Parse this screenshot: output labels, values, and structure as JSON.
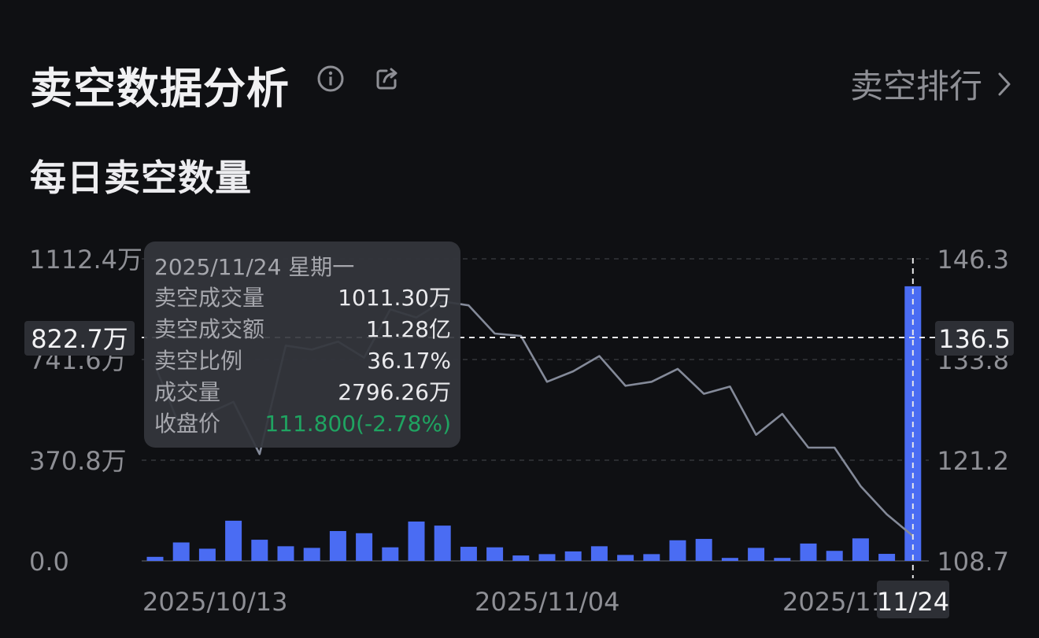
{
  "header": {
    "title": "卖空数据分析",
    "ranking_label": "卖空排行",
    "icons": [
      "info-icon",
      "share-icon",
      "chevron-right-icon"
    ]
  },
  "section": {
    "title": "每日卖空数量"
  },
  "colors": {
    "bar": "#4a6cf3",
    "line": "#848a99",
    "grid": "#33353b",
    "positive": "#1fa461",
    "background": "#0f1013"
  },
  "tooltip": {
    "date": "2025/11/24 星期一",
    "rows": [
      {
        "label": "卖空成交量",
        "value": "1011.30万"
      },
      {
        "label": "卖空成交额",
        "value": "11.28亿"
      },
      {
        "label": "卖空比例",
        "value": "36.17%"
      },
      {
        "label": "成交量",
        "value": "2796.26万"
      },
      {
        "label": "收盘价",
        "value": "111.800(-2.78%)"
      }
    ]
  },
  "chart_data": {
    "type": "bar",
    "x_tick_labels": [
      "2025/10/13",
      "2025/11/04",
      "2025/11/24"
    ],
    "x_tick_indices": [
      0,
      13,
      29
    ],
    "left_axis": {
      "ticks": [
        "0.0",
        "370.8万",
        "741.6万",
        "1112.4万"
      ],
      "min": 0,
      "max": 1112.4,
      "unit": "万"
    },
    "right_axis": {
      "ticks": [
        "108.7",
        "121.2",
        "133.8",
        "146.3"
      ],
      "min": 108.7,
      "max": 146.3
    },
    "crosshair": {
      "left_value_label": "822.7万",
      "right_value_label": "136.5",
      "x_label": "11/24",
      "index": 29
    },
    "series": [
      {
        "axis": "left",
        "values": [
          15,
          68,
          45,
          148,
          78,
          54,
          48,
          110,
          102,
          50,
          145,
          130,
          52,
          50,
          20,
          25,
          35,
          54,
          22,
          25,
          76,
          81,
          11,
          48,
          11,
          64,
          37,
          83,
          26,
          1011.3
        ]
      },
      {
        "axis": "right",
        "values": [
          133.0,
          125.0,
          127.0,
          128.5,
          122.0,
          135.5,
          135.0,
          136.0,
          134.0,
          140.0,
          139.0,
          141.0,
          140.5,
          137.0,
          136.7,
          131.0,
          132.3,
          134.2,
          130.5,
          131.0,
          132.6,
          129.5,
          130.4,
          124.4,
          127.0,
          122.8,
          122.8,
          118.0,
          114.5,
          111.8
        ]
      }
    ],
    "grid": true
  }
}
